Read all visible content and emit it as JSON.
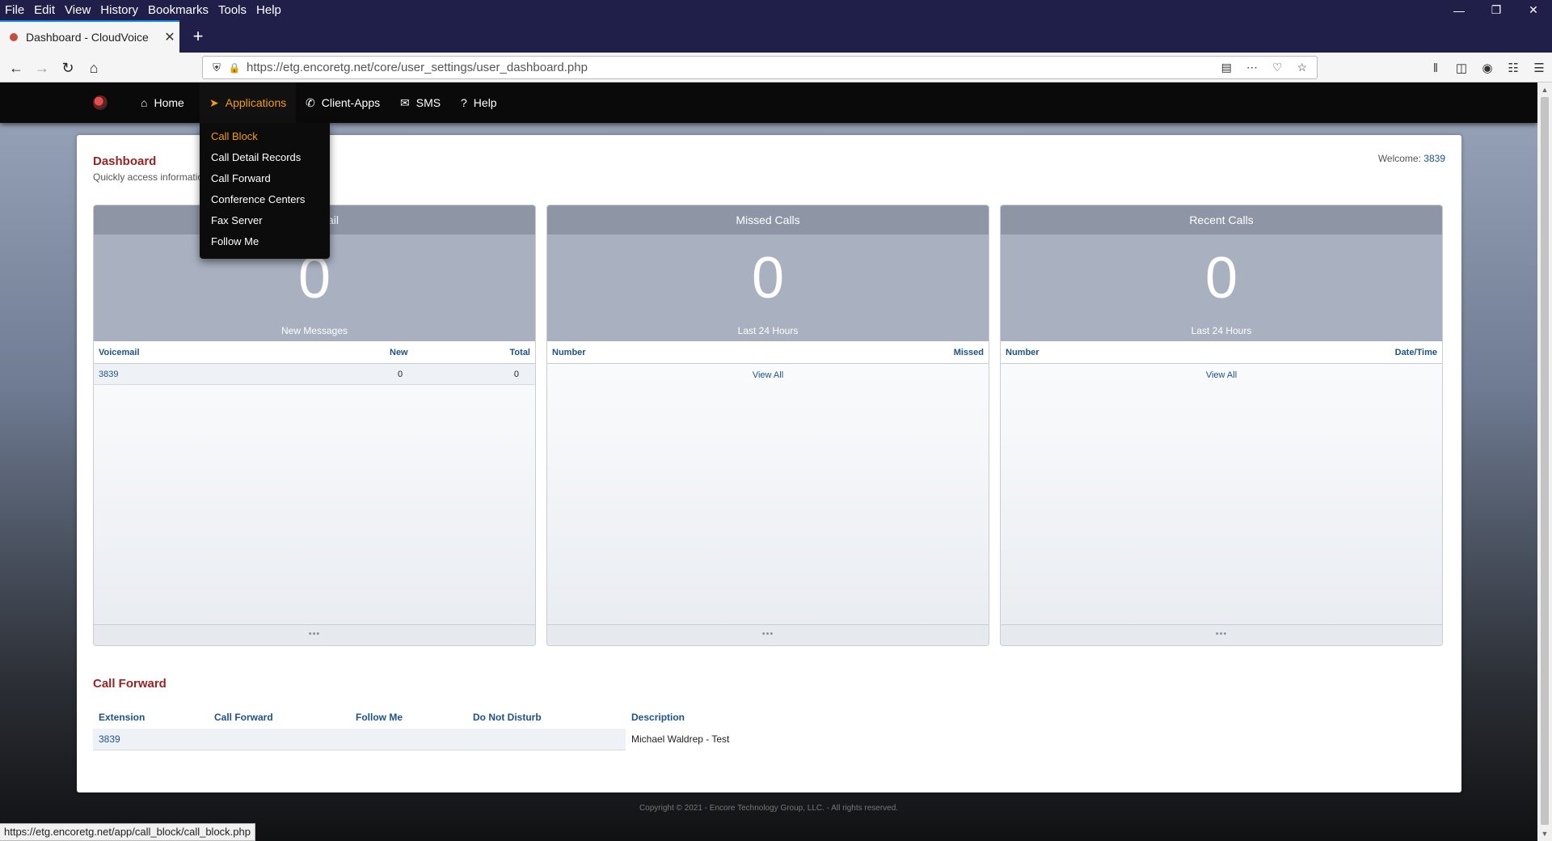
{
  "menubar": {
    "items": [
      "File",
      "Edit",
      "View",
      "History",
      "Bookmarks",
      "Tools",
      "Help"
    ]
  },
  "window_controls": {
    "minimize": "—",
    "restore": "❐",
    "close": "✕"
  },
  "tab": {
    "title": "Dashboard - CloudVoice",
    "close": "✕",
    "new_tab": "+"
  },
  "navbar": {
    "url": "https://etg.encoretg.net/core/user_settings/user_dashboard.php"
  },
  "app_nav": {
    "home": "Home",
    "applications": "Applications",
    "client_apps": "Client-Apps",
    "sms": "SMS",
    "help": "Help"
  },
  "applications_menu": [
    "Call Block",
    "Call Detail Records",
    "Call Forward",
    "Conference Centers",
    "Fax Server",
    "Follow Me"
  ],
  "dashboard": {
    "title": "Dashboard",
    "description": "Quickly access information assigned to your account.",
    "welcome_label": "Welcome:",
    "welcome_user": "3839"
  },
  "widgets": {
    "voicemail": {
      "title": "Voicemail",
      "count": "0",
      "subtitle": "New Messages",
      "columns": [
        "Voicemail",
        "New",
        "Total"
      ],
      "rows": [
        {
          "voicemail": "3839",
          "new": "0",
          "total": "0"
        }
      ],
      "footer": "•••"
    },
    "missed": {
      "title": "Missed Calls",
      "count": "0",
      "subtitle": "Last 24 Hours",
      "columns": [
        "Number",
        "Missed"
      ],
      "view_all": "View All",
      "footer": "•••"
    },
    "recent": {
      "title": "Recent Calls",
      "count": "0",
      "subtitle": "Last 24 Hours",
      "columns": [
        "Number",
        "Date/Time"
      ],
      "view_all": "View All",
      "footer": "•••"
    }
  },
  "call_forward": {
    "title": "Call Forward",
    "columns": [
      "Extension",
      "Call Forward",
      "Follow Me",
      "Do Not Disturb",
      "Description"
    ],
    "rows": [
      {
        "extension": "3839",
        "call_forward": "",
        "follow_me": "",
        "dnd": "",
        "description": "Michael Waldrep - Test"
      }
    ]
  },
  "copyright": "Copyright © 2021 - Encore Technology Group, LLC. - All rights reserved.",
  "statusbar": {
    "url": "https://etg.encoretg.net/app/call_block/call_block.php"
  },
  "colors": {
    "accent": "#f39c12",
    "title_red": "#952424",
    "link_blue": "#1d5387",
    "widget_header": "#8e96a6"
  }
}
